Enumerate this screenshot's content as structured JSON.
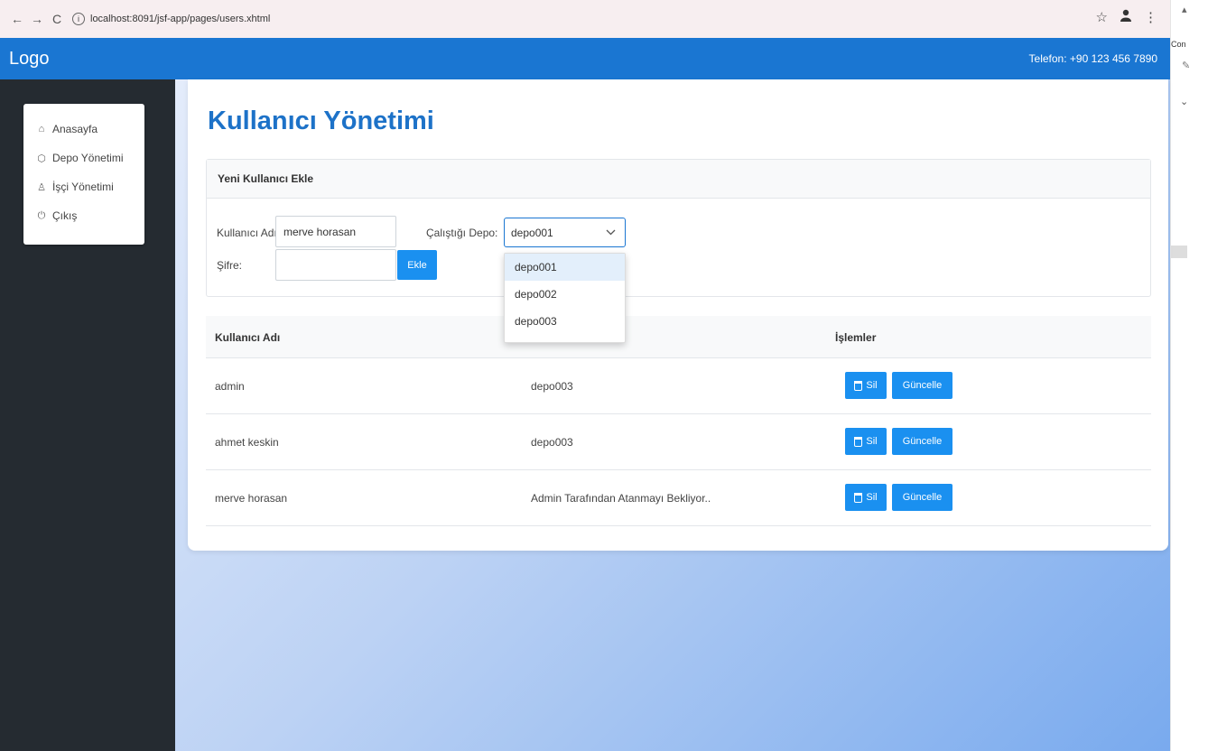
{
  "browser": {
    "url": "localhost:8091/jsf-app/pages/users.xhtml",
    "back": "←",
    "forward": "→",
    "reload": "C",
    "info": "i",
    "star": "☆",
    "more": "⋮",
    "side_text": "Con"
  },
  "header": {
    "logo": "Logo",
    "phone": "Telefon: +90 123 456 7890"
  },
  "sidebar": {
    "items": [
      {
        "label": "Anasayfa",
        "icon": "home-icon",
        "glyph": "⌂"
      },
      {
        "label": "Depo Yönetimi",
        "icon": "box-icon",
        "glyph": "⬡"
      },
      {
        "label": "İşçi Yönetimi",
        "icon": "users-icon",
        "glyph": "♙"
      },
      {
        "label": "Çıkış",
        "icon": "power-icon",
        "glyph": "⏻"
      }
    ]
  },
  "page": {
    "title": "Kullanıcı Yönetimi"
  },
  "form": {
    "heading": "Yeni Kullanıcı Ekle",
    "username_label": "Kullanıcı Adı:",
    "username_value": "merve horasan",
    "password_label": "Şifre:",
    "password_value": "",
    "depot_label": "Çalıştığı Depo:",
    "depot_value": "depo001",
    "add_button": "Ekle",
    "depot_options": [
      "depo001",
      "depo002",
      "depo003"
    ]
  },
  "table": {
    "headers": [
      "Kullanıcı Adı",
      "İşlemler"
    ],
    "delete_label": "Sil",
    "update_label": "Güncelle",
    "rows": [
      {
        "username": "admin",
        "depot": "depo003"
      },
      {
        "username": "ahmet keskin",
        "depot": "depo003"
      },
      {
        "username": "merve horasan",
        "depot": "Admin Tarafından Atanmayı Bekliyor.."
      }
    ]
  },
  "colors": {
    "primary": "#1a76d2",
    "button": "#1a90f0",
    "sidebar": "#252b31",
    "title": "#1d72c8"
  }
}
